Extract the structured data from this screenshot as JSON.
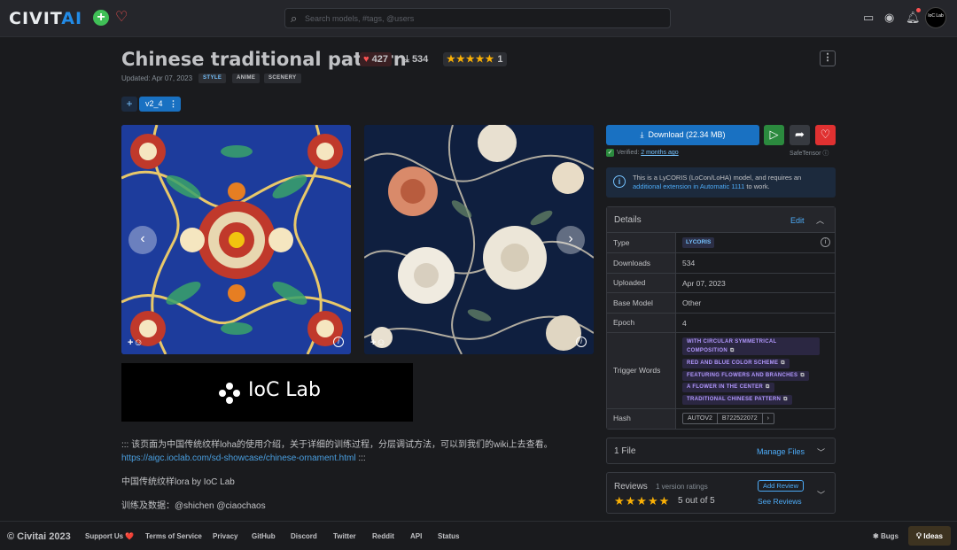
{
  "header": {
    "logo_text": "CIVIT",
    "logo_accent": "AI",
    "search_placeholder": "Search models, #tags, @users",
    "avatar_text": "IoC Lab"
  },
  "model": {
    "title": "Chinese traditional pattern",
    "likes": "427",
    "downloads": "534",
    "rating_count": "1",
    "updated": "Updated: Apr 07, 2023",
    "tags": [
      "STYLE",
      "ANIME",
      "SCENERY"
    ],
    "version_tab": "v2_4"
  },
  "description": {
    "line1": "::: 该页面为中国传统纹样loha的使用介绍，关于详细的训练过程，分层调试方法，可以到我们的wiki上去查看。",
    "link": "https://aigc.ioclab.com/sd-showcase/chinese-ornament.html",
    "link_suffix": " :::",
    "line2": "中国传统纹样lora by IoC Lab",
    "line3": "训练及数据：@shichen @ciaochaos",
    "banner_text": "IoC Lab"
  },
  "sidebar": {
    "download_label": "Download (22.34 MB)",
    "verified_prefix": "Verified: ",
    "verified_time": "2 months ago",
    "safetensor": "SafeTensor",
    "alert_prefix": "This is a LyCORIS (LoCon/LoHA) model, and requires an ",
    "alert_link": "additional extension in Automatic 1111",
    "alert_suffix": " to work.",
    "details_title": "Details",
    "edit_label": "Edit",
    "rows": {
      "type_label": "Type",
      "type_value": "LYCORIS",
      "downloads_label": "Downloads",
      "downloads_value": "534",
      "uploaded_label": "Uploaded",
      "uploaded_value": "Apr 07, 2023",
      "base_label": "Base Model",
      "base_value": "Other",
      "epoch_label": "Epoch",
      "epoch_value": "4",
      "trigger_label": "Trigger Words",
      "hash_label": "Hash",
      "hash_type": "AUTOV2",
      "hash_value": "B722522072"
    },
    "trigger_words": [
      "WITH CIRCULAR SYMMETRICAL COMPOSITION",
      "RED AND BLUE COLOR SCHEME",
      "FEATURING FLOWERS AND BRANCHES",
      "A FLOWER IN THE CENTER",
      "TRADITIONAL CHINESE PATTERN"
    ],
    "files_label": "1 File",
    "manage_files": "Manage Files",
    "reviews_label": "Reviews",
    "reviews_count": "1 version ratings",
    "reviews_out_of": "5 out of 5",
    "add_review": "Add Review",
    "see_reviews": "See Reviews"
  },
  "footer": {
    "copyright": "© Civitai 2023",
    "links": [
      "Support Us ❤️",
      "Terms of Service",
      "Privacy",
      "GitHub",
      "Discord",
      "Twitter",
      "Reddit",
      "API",
      "Status"
    ],
    "bugs": "Bugs",
    "ideas": "Ideas"
  },
  "colors": {
    "accent": "#1971c2",
    "like": "#fa5252",
    "star": "#fab005",
    "trigger": "#b197fc"
  }
}
